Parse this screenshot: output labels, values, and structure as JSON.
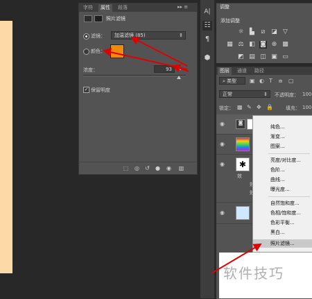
{
  "properties": {
    "tabs": [
      "字符",
      "属性",
      "段落"
    ],
    "active_tab": "属性",
    "panel_menu": "▸▸ ≡",
    "title": "照片滤镜",
    "filter_label": "滤镜：",
    "filter_value": "加温滤镜 (85)",
    "color_label": "颜色：",
    "color_hex": "#f08a0a",
    "density_label": "浓度：",
    "density_value": "93",
    "density_unit": "%",
    "density_fraction": 0.93,
    "preserve_label": "保留明度",
    "preserve_checked": true
  },
  "adjustments": {
    "tab": "调整",
    "add_label": "添加调整"
  },
  "layers": {
    "tabs": [
      "图层",
      "通道",
      "路径"
    ],
    "active_tab": "图层",
    "kind_label": "类型",
    "blend_mode": "正常",
    "opacity_label": "不透明度：",
    "opacity_value": "100",
    "lock_label": "锁定：",
    "fill_label": "填充：",
    "fill_value": "100",
    "thumb_colors": [
      "#ffffff",
      "#3ddc50",
      "#ffffff",
      "#cfe6ff"
    ],
    "sub_labels": [
      "效",
      "效",
      "效"
    ]
  },
  "menu": {
    "items": [
      "纯色...",
      "渐变...",
      "图案...",
      "亮度/对比度...",
      "色阶...",
      "曲线...",
      "曝光度...",
      "自然饱和度...",
      "色相/饱和度...",
      "色彩平衡...",
      "黑白...",
      "照片滤镜..."
    ],
    "highlighted": "照片滤镜..."
  },
  "toolstrip": {
    "char_icon": "A|",
    "para_icon": "¶"
  },
  "watermark": "软件技巧",
  "colors": {
    "canvas": "#fed9a8",
    "annotation": "#e00000"
  }
}
